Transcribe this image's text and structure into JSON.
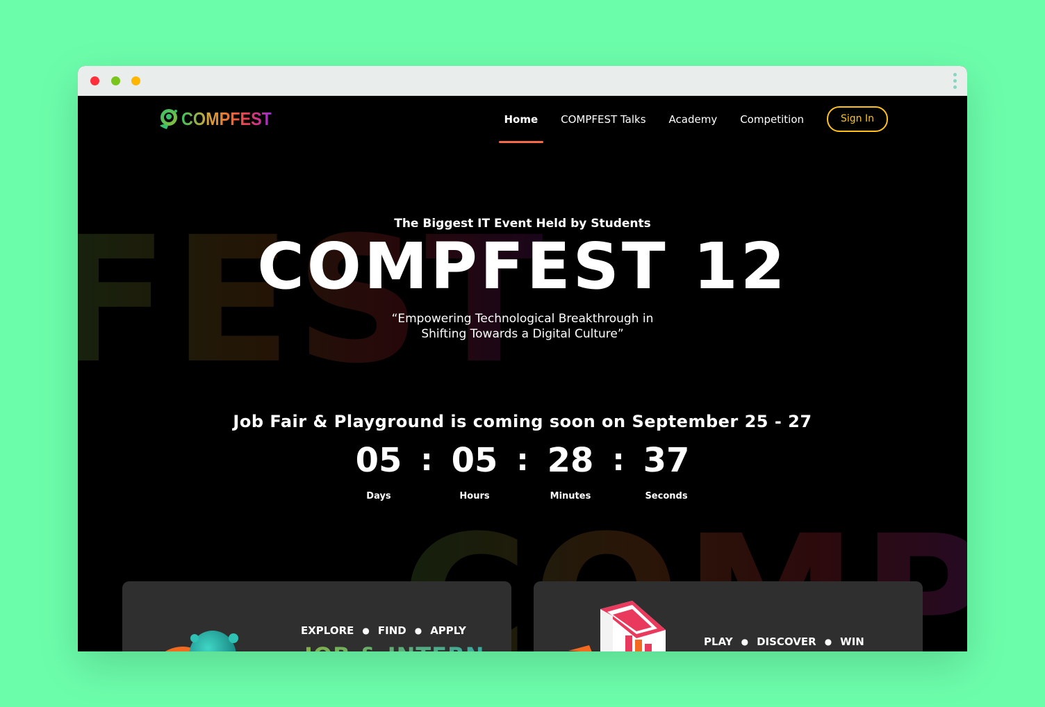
{
  "colors": {
    "page_bg": "#6cfdab",
    "accent_underline": "#f46b45",
    "signin": "#ffc21a"
  },
  "window": {
    "controls": [
      "close",
      "minimize",
      "zoom"
    ],
    "menu_icon": "kebab-icon"
  },
  "brand": {
    "name": "COMPFEST",
    "logo_icon": "compfest-mascot-icon"
  },
  "nav": {
    "items": [
      {
        "label": "Home",
        "active": true
      },
      {
        "label": "COMPFEST Talks",
        "active": false
      },
      {
        "label": "Academy",
        "active": false
      },
      {
        "label": "Competition",
        "active": false
      }
    ],
    "signin_label": "Sign In"
  },
  "background": {
    "word_top": "FEST",
    "word_bottom": "COMP"
  },
  "hero": {
    "subtitle": "The Biggest IT Event Held by Students",
    "title": "COMPFEST 12",
    "tagline_line1": "“Empowering Technological Breakthrough in",
    "tagline_line2": "Shifting Towards a Digital Culture”"
  },
  "countdown": {
    "heading": "Job Fair & Playground is coming soon on September 25 - 27",
    "units": [
      {
        "value": "05",
        "label": "Days"
      },
      {
        "value": "05",
        "label": "Hours"
      },
      {
        "value": "28",
        "label": "Minutes"
      },
      {
        "value": "37",
        "label": "Seconds"
      }
    ],
    "separator": ":"
  },
  "cards": {
    "left": {
      "tags": [
        "EXPLORE",
        "FIND",
        "APPLY"
      ],
      "title": "JOB & INTERN"
    },
    "right": {
      "tags": [
        "PLAY",
        "DISCOVER",
        "WIN"
      ]
    }
  }
}
